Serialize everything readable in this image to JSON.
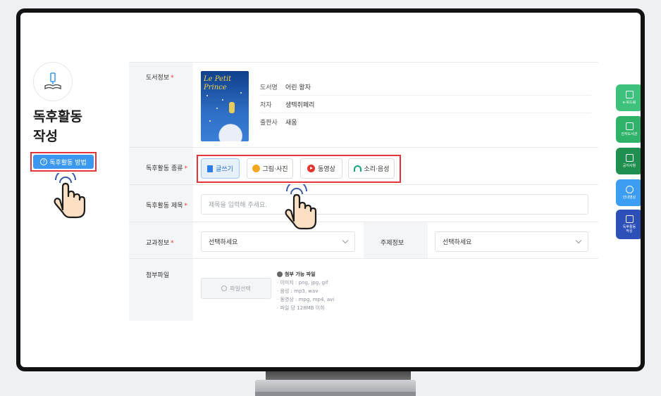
{
  "page": {
    "title_line1": "독후활동",
    "title_line2": "작성",
    "howto_label": "독후활동 방법"
  },
  "form": {
    "book_info_label": "도서정보",
    "book": {
      "cover_title": "Le Petit Prince",
      "title_key": "도서명",
      "title_value": "어린 왕자",
      "author_key": "저자",
      "author_value": "생텍쥐페리",
      "publisher_key": "출판사",
      "publisher_value": "새움"
    },
    "activity_type_label": "독후활동 종류",
    "activity_types": [
      {
        "label": "글쓰기",
        "active": true
      },
      {
        "label": "그림·사진",
        "active": false
      },
      {
        "label": "동영상",
        "active": false
      },
      {
        "label": "소리·음성",
        "active": false
      }
    ],
    "activity_title_label": "독후활동 제목",
    "activity_title_placeholder": "제목을 입력해 주세요.",
    "subject_label": "교과정보",
    "subject_value": "선택하세요",
    "theme_label": "주제정보",
    "theme_value": "선택하세요",
    "attachment_label": "첨부파일",
    "file_select_label": "파일선택",
    "file_info_title": "첨부 가능 파일",
    "file_info_lines": [
      "· 이미지 : png, jpg, gif",
      "· 음성 : mp3, wav",
      "· 동영상 : mpg, mp4, avi",
      "· 파일 당 128MB 이하"
    ],
    "required_mark": "*"
  },
  "quick_menu": [
    {
      "label": "e-북드림",
      "icon": "phone-book-icon",
      "color": "#3cc27a"
    },
    {
      "label": "전자도서관",
      "icon": "open-book-icon",
      "color": "#2fb36a"
    },
    {
      "label": "공지사항",
      "icon": "megaphone-icon",
      "color": "#1e8f4e"
    },
    {
      "label": "안내영상",
      "icon": "play-circle-icon",
      "color": "#3d9df2"
    },
    {
      "label": "독후활동\n작성",
      "icon": "pencil-icon",
      "color": "#2c4fb8"
    }
  ],
  "colors": {
    "accent_blue": "#3b97f0",
    "highlight_red": "#e5343a"
  }
}
